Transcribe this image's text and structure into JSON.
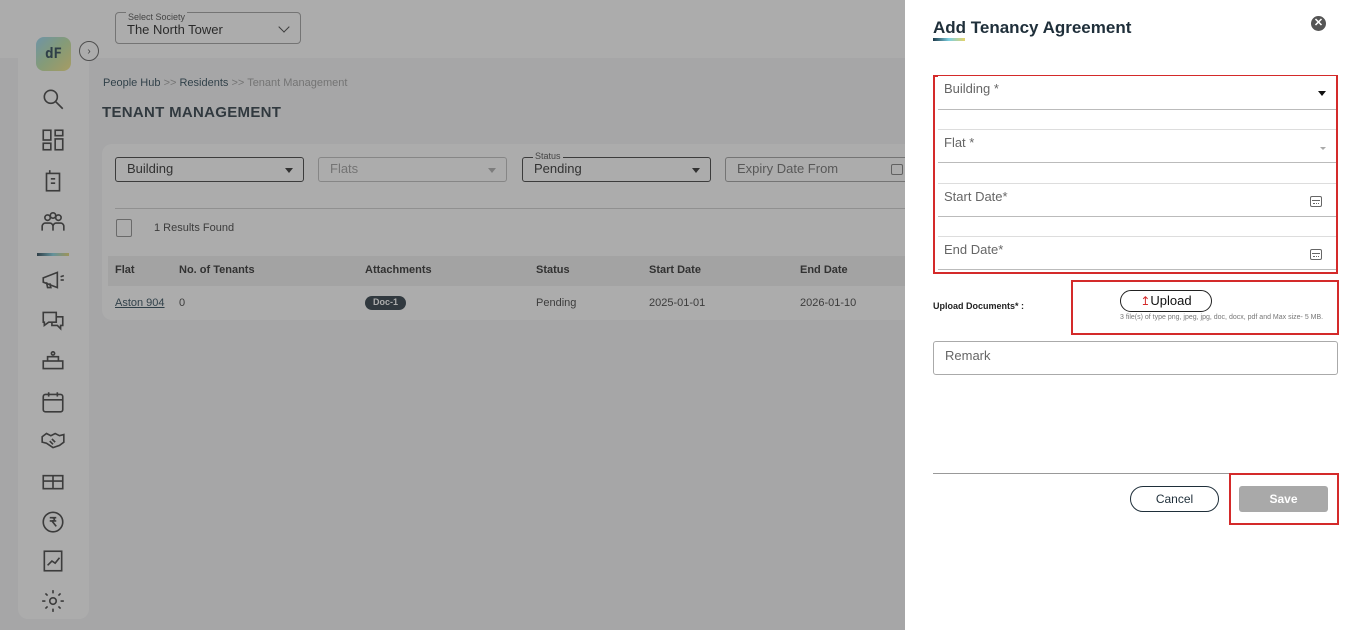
{
  "topbar": {
    "society_label": "Select Society",
    "society_value": "The North Tower"
  },
  "sidebar": {
    "logo_text": "dF",
    "items": [
      "search-icon",
      "dashboard-icon",
      "building-icon",
      "people-icon",
      "megaphone-icon",
      "chat-icon",
      "amenities-icon",
      "calendar-icon",
      "handshake-icon",
      "gift-icon",
      "rupee-icon",
      "report-icon",
      "settings-icon"
    ]
  },
  "breadcrumb": {
    "items": [
      "People Hub",
      "Residents",
      "Tenant Management"
    ],
    "separator": ">>"
  },
  "page_title": "TENANT MANAGEMENT",
  "filters": {
    "building": "Building",
    "flats": "Flats",
    "status_label": "Status",
    "status_value": "Pending",
    "expiry_from": "Expiry Date From"
  },
  "results_text": "1 Results Found",
  "table": {
    "columns": [
      "Flat",
      "No. of Tenants",
      "Attachments",
      "Status",
      "Start Date",
      "End Date"
    ],
    "rows": [
      {
        "flat": "Aston 904",
        "tenants": "0",
        "attachment": "Doc-1",
        "status": "Pending",
        "start": "2025-01-01",
        "end": "2026-01-10"
      }
    ]
  },
  "drawer": {
    "title": "Add Tenancy Agreement",
    "close": "✕",
    "fields": {
      "building": "Building *",
      "flat": "Flat *",
      "start_date": "Start Date*",
      "end_date": "End Date*"
    },
    "upload_label": "Upload Documents* :",
    "upload_button": "Upload",
    "upload_icon": "↥",
    "upload_hint": "3 file(s) of type png, jpeg, jpg, doc, docx, pdf and Max size- 5 MB.",
    "remark": "Remark",
    "cancel": "Cancel",
    "save": "Save"
  },
  "colors": {
    "highlight": "#d42a2a",
    "brand_dark": "#1f2f3a",
    "save_disabled": "#a9a9a9"
  }
}
